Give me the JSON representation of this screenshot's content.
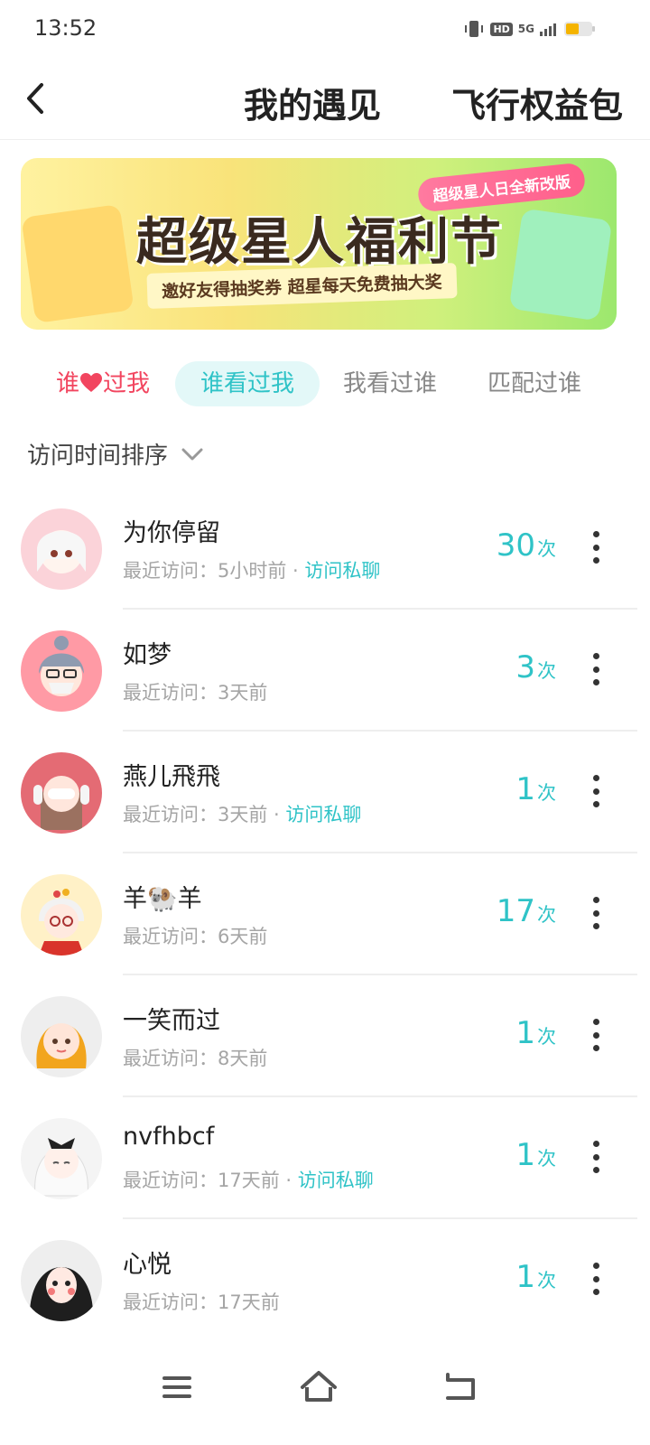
{
  "status_bar": {
    "time": "13:52",
    "hd": "HD",
    "network": "5G"
  },
  "header": {
    "title": "我的遇见",
    "right_action": "飞行权益包"
  },
  "banner": {
    "badge": "超级星人日全新改版",
    "title": "超级星人福利节",
    "subtitle": "邀好友得抽奖券 超星每天免费抽大奖"
  },
  "tabs": {
    "liked_prefix": "谁",
    "liked_suffix": "过我",
    "viewed_me": "谁看过我",
    "i_viewed": "我看过谁",
    "matched": "匹配过谁",
    "active": "谁看过我"
  },
  "sort": {
    "label": "访问时间排序"
  },
  "visitor_list": {
    "meta_prefix": "最近访问：",
    "unit": "次",
    "items": [
      {
        "name": "为你停留",
        "last_visit": "5小时前",
        "chat": "访问私聊",
        "count": "30"
      },
      {
        "name": "如梦",
        "last_visit": "3天前",
        "chat": "",
        "count": "3"
      },
      {
        "name": "燕儿飛飛",
        "last_visit": "3天前",
        "chat": "访问私聊",
        "count": "1"
      },
      {
        "name": "羊🐏羊",
        "last_visit": "6天前",
        "chat": "",
        "count": "17"
      },
      {
        "name": "一笑而过",
        "last_visit": "8天前",
        "chat": "",
        "count": "1"
      },
      {
        "name": "nvfhbcf",
        "last_visit": "17天前",
        "chat": "访问私聊",
        "count": "1"
      },
      {
        "name": "心悦",
        "last_visit": "17天前",
        "chat": "",
        "count": "1"
      }
    ]
  },
  "colors": {
    "accent": "#2fc3c7",
    "heart": "#f2455f",
    "text_muted": "#a5a5a5"
  },
  "icons": {
    "back": "chevron-left-icon",
    "sort": "chevron-down-icon",
    "more": "more-vertical-icon",
    "nav_menu": "menu-icon",
    "nav_home": "home-icon",
    "nav_back": "return-icon"
  }
}
